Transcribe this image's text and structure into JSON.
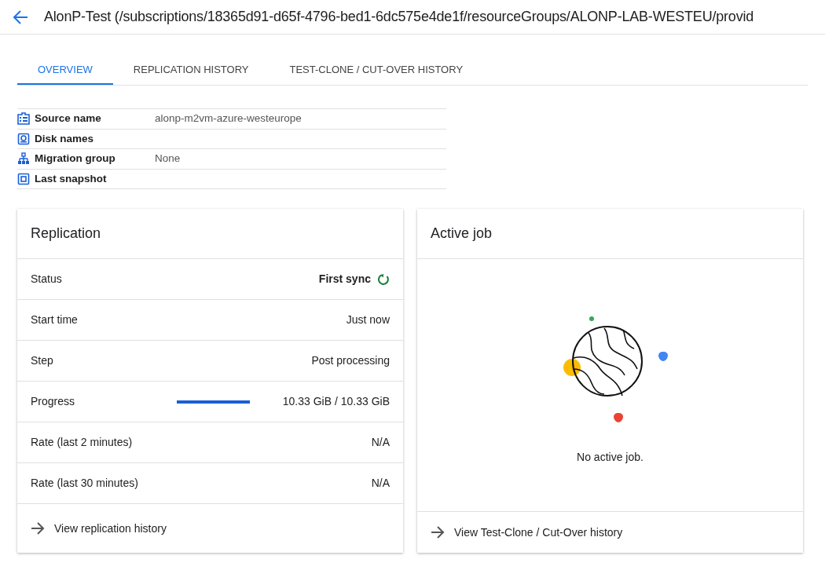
{
  "header": {
    "title": "AlonP-Test (/subscriptions/18365d91-d65f-4796-bed1-6dc575e4de1f/resourceGroups/ALONP-LAB-WESTEU/provid"
  },
  "tabs": [
    {
      "label": "OVERVIEW",
      "selected": true
    },
    {
      "label": "REPLICATION HISTORY",
      "selected": false
    },
    {
      "label": "TEST-CLONE / CUT-OVER HISTORY",
      "selected": false
    }
  ],
  "details": [
    {
      "kind": "source",
      "label": "Source name",
      "value": "alonp-m2vm-azure-westeurope"
    },
    {
      "kind": "disk",
      "label": "Disk names"
    },
    {
      "kind": "group",
      "label": "Migration group",
      "value": "None"
    },
    {
      "kind": "snapshot",
      "label": "Last snapshot"
    }
  ],
  "replication": {
    "title": "Replication",
    "rows": [
      {
        "kind": "status",
        "label": "Status",
        "value": "First sync"
      },
      {
        "kind": "text",
        "label": "Start time",
        "value": "Just now"
      },
      {
        "kind": "text",
        "label": "Step",
        "value": "Post processing"
      },
      {
        "kind": "progress",
        "label": "Progress",
        "level": 1,
        "value": "10.33 GiB / 10.33 GiB"
      },
      {
        "kind": "text",
        "label": "Rate (last 2 minutes)",
        "value": "N/A"
      },
      {
        "kind": "text",
        "label": "Rate (last 30 minutes)",
        "value": "N/A"
      }
    ],
    "link": "View replication history"
  },
  "active_job": {
    "title": "Active job",
    "message": "No active job.",
    "link": "View Test-Clone / Cut-Over history"
  }
}
